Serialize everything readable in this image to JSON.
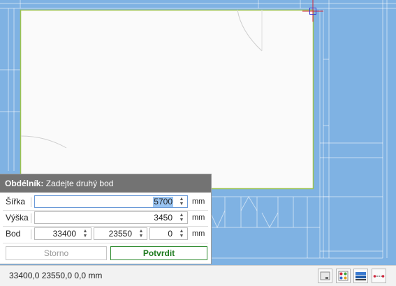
{
  "dialog": {
    "title_bold": "Obdélník:",
    "title_rest": "Zadejte druhý bod",
    "fields": {
      "width_label": "Šířka",
      "width_value": "5700",
      "width_unit": "mm",
      "height_label": "Výška",
      "height_value": "3450",
      "height_unit": "mm",
      "point_label": "Bod",
      "point_x": "33400",
      "point_y": "23550",
      "point_z": "0",
      "point_unit": "mm"
    },
    "cancel_label": "Storno",
    "confirm_label": "Potvrdit"
  },
  "statusbar": {
    "coords": "33400,0  23550,0  0,0  mm"
  },
  "icons": {
    "spinner": "spinner-arrows-icon",
    "statusbar_buttons": [
      "view-snap-icon",
      "object-snap-icon",
      "layers-icon",
      "dimension-icon"
    ]
  },
  "colors": {
    "canvas_bg": "#7fb2e3",
    "rectangle_fill": "#fafafa",
    "rectangle_border": "#9bc24f",
    "cursor": "#d0243a",
    "dialog_title_bg": "#737373",
    "confirm": "#1e7a1e"
  }
}
